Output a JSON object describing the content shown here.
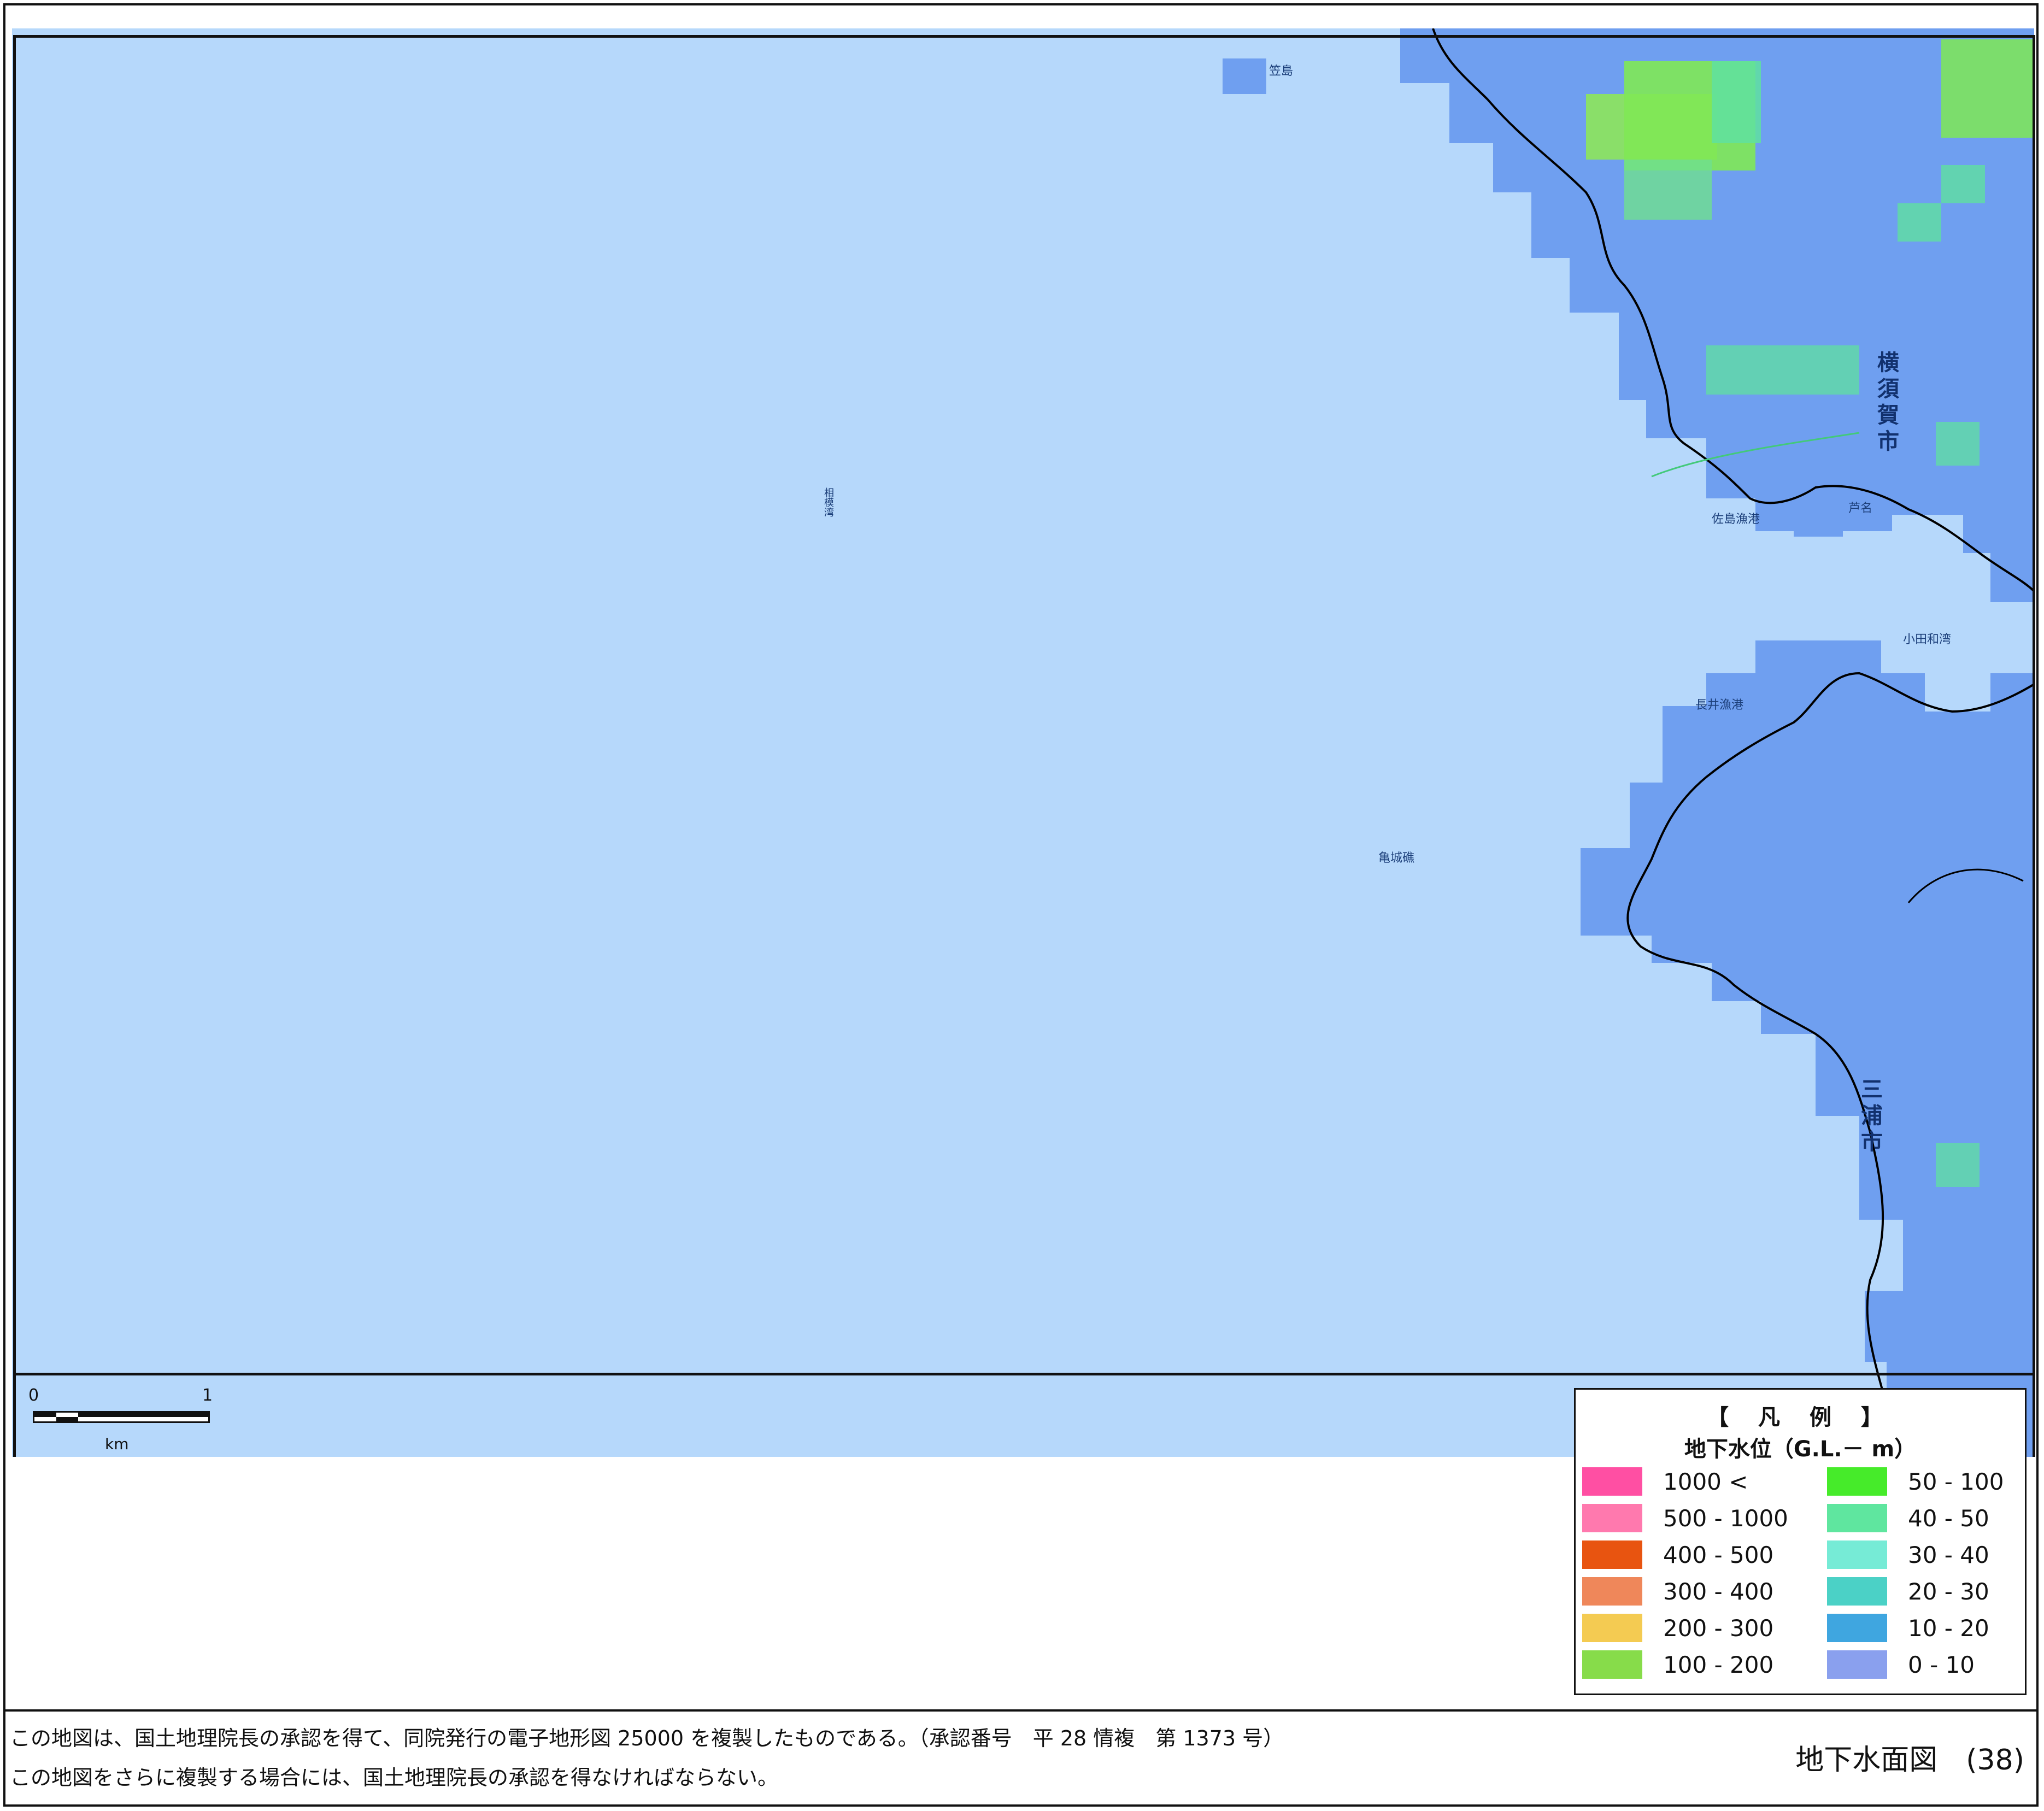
{
  "map": {
    "colors": {
      "sea": "#b6d8fb",
      "land_base": "#7aaaf0",
      "cell_0_10": "#86a0ea",
      "cell_10_20": "#3fa6e0",
      "cell_40_50": "#5fe0a0",
      "cell_50_100": "#7df04a",
      "coastline": "#000000"
    },
    "labels": {
      "city_yokosuka": "横須賀市",
      "city_miura": "三浦市",
      "sagami_bay": "相模湾",
      "island_north": "笠島",
      "island_west": "亀城礁",
      "fishing_port_1": "佐島漁港",
      "fishing_port_2": "長井漁港",
      "kotawa_bay": "小田和湾",
      "temple": "芦名"
    }
  },
  "scale_bar": {
    "start": "0",
    "end": "1",
    "unit": "km"
  },
  "legend": {
    "title": "【 凡 例 】",
    "subtitle": "地下水位（G.L.－ m）",
    "items": [
      {
        "label": "1000 <",
        "color": "#ff4fa3"
      },
      {
        "label": "500 - 1000",
        "color": "#ff79ae"
      },
      {
        "label": "400 - 500",
        "color": "#e85410"
      },
      {
        "label": "300 - 400",
        "color": "#ef875a"
      },
      {
        "label": "200 - 300",
        "color": "#f4cb52"
      },
      {
        "label": "100 - 200",
        "color": "#87dc4a"
      },
      {
        "label": "50 - 100",
        "color": "#46eb2a"
      },
      {
        "label": "40 - 50",
        "color": "#5fe69f"
      },
      {
        "label": "30 - 40",
        "color": "#76ebd6"
      },
      {
        "label": "20 - 30",
        "color": "#4bd1c6"
      },
      {
        "label": "10 - 20",
        "color": "#3fa6e0"
      },
      {
        "label": "0 - 10",
        "color": "#8aa0ee"
      }
    ]
  },
  "footer": {
    "note_1": "この地図は、国土地理院長の承認を得て、同院発行の電子地形図 25000 を複製したものである。（承認番号　平 28 情複　第 1373 号）",
    "note_2": "この地図をさらに複製する場合には、国土地理院長の承認を得なければならない。",
    "sheet_title": "地下水面図　(38)"
  }
}
